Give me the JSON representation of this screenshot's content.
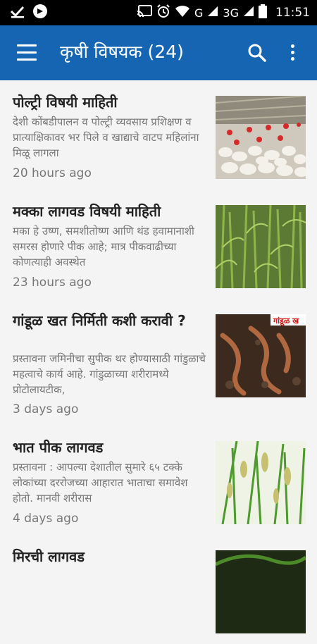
{
  "status_bar": {
    "network_label": "G",
    "network2_label": "3G",
    "time": "11:51"
  },
  "app_bar": {
    "title": "कृषी विषयक (24)",
    "menu_icon": "hamburger-menu-icon",
    "search_icon": "search-icon",
    "more_icon": "more-vert-icon",
    "color": "#1565b3"
  },
  "articles": [
    {
      "title": "पोल्ट्री विषयी माहिती",
      "description": "देशी कोंबडीपालन व पोल्ट्री व्यवसाय प्रशिक्षण व प्रात्याक्षिकावर भर पिले व खाद्याचे वाटप महिलांना मिळू लागला",
      "time": "20 hours ago",
      "image": "poultry-farm"
    },
    {
      "title": "मक्का लागवड विषयी माहिती",
      "description": "मका हे उष्ण, समशीतोष्ण आणि थंड हवामानाशी समरस होणारे पीक आहे; मात्र पीकवाढीच्या कोणत्याही अवस्थेत",
      "time": "23 hours ago",
      "image": "maize-field"
    },
    {
      "title": "गांडूळ खत निर्मिती कशी करावी ?",
      "description": "प्रस्तावना जमिनीचा सुपीक थर होण्यासाठी गांडुळाचे महत्वाचे कार्य आहे. गांडुळाच्या शरीरामध्ये प्रोटोलायटीक,",
      "time": "3 days ago",
      "image": "earthworms",
      "image_caption": "गांडूळ ख"
    },
    {
      "title": "भात पीक लागवड",
      "description": "प्रस्तावना : आपल्या देशातील सुमारे ६५ टक्के लोकांच्या दररोजच्या आहारात भाताचा समावेश होतो. मानवी शरीरास",
      "time": "4 days ago",
      "image": "rice-crop"
    },
    {
      "title": "मिरची लागवड",
      "image": "chilli-plant"
    }
  ]
}
